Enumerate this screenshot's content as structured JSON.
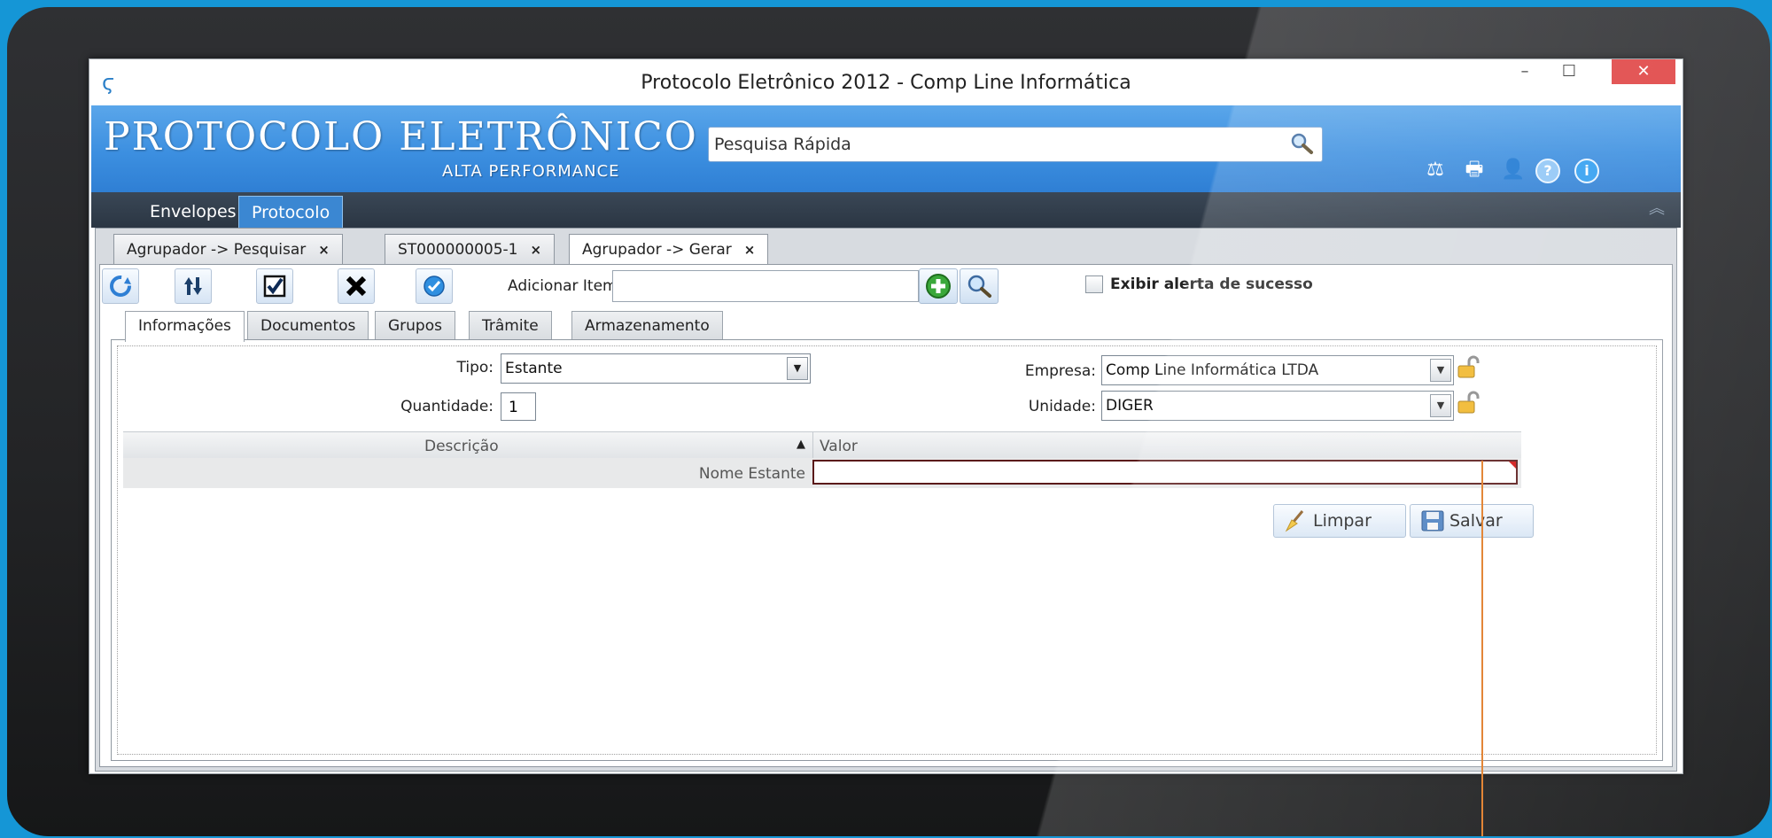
{
  "window": {
    "title": "Protocolo Eletrônico 2012 - Comp Line Informática",
    "minimize": "–",
    "maximize": "☐",
    "close": "✕"
  },
  "header": {
    "brand": "Protocolo Eletrônico",
    "tagline": "ALTA PERFORMANCE",
    "search_placeholder": "Pesquisa Rápida",
    "icons": [
      "scales-icon",
      "printer-icon",
      "user-icon",
      "help-icon",
      "info-icon"
    ]
  },
  "nav": {
    "tabs": [
      {
        "label": "Envelopes",
        "active": false
      },
      {
        "label": "Protocolo",
        "active": true
      }
    ],
    "collapse": "︽"
  },
  "doc_tabs": [
    {
      "label": "Agrupador -> Pesquisar",
      "close": "×",
      "active": false
    },
    {
      "label": "ST000000005-1",
      "close": "×",
      "active": false
    },
    {
      "label": "Agrupador -> Gerar",
      "close": "×",
      "active": true
    }
  ],
  "toolbar": {
    "add_item_label": "Adicionar Item:",
    "add_item_value": "",
    "show_success_alert_label": "Exibir alerta de sucesso",
    "show_success_alert_checked": false
  },
  "inner_tabs": [
    {
      "label": "Informações",
      "active": true
    },
    {
      "label": "Documentos",
      "active": false
    },
    {
      "label": "Grupos",
      "active": false
    },
    {
      "label": "Trâmite",
      "active": false
    },
    {
      "label": "Armazenamento",
      "active": false
    }
  ],
  "form": {
    "tipo_label": "Tipo:",
    "tipo_value": "Estante",
    "quantidade_label": "Quantidade:",
    "quantidade_value": "1",
    "empresa_label": "Empresa:",
    "empresa_value": "Comp Line Informática LTDA",
    "unidade_label": "Unidade:",
    "unidade_value": "DIGER"
  },
  "grid": {
    "columns": [
      "Descrição",
      "Valor"
    ],
    "sort_glyph": "▲",
    "rows": [
      {
        "descricao": "Nome Estante",
        "valor": ""
      }
    ]
  },
  "actions": {
    "clear_label": "Limpar",
    "save_label": "Salvar"
  },
  "colors": {
    "page_bg": "#1596d6",
    "header_blue": "#3c8fe0",
    "nav_dark": "#2b3643",
    "active_tab": "#3b87d2",
    "close_red": "#e04343",
    "callout": "#e07820"
  }
}
